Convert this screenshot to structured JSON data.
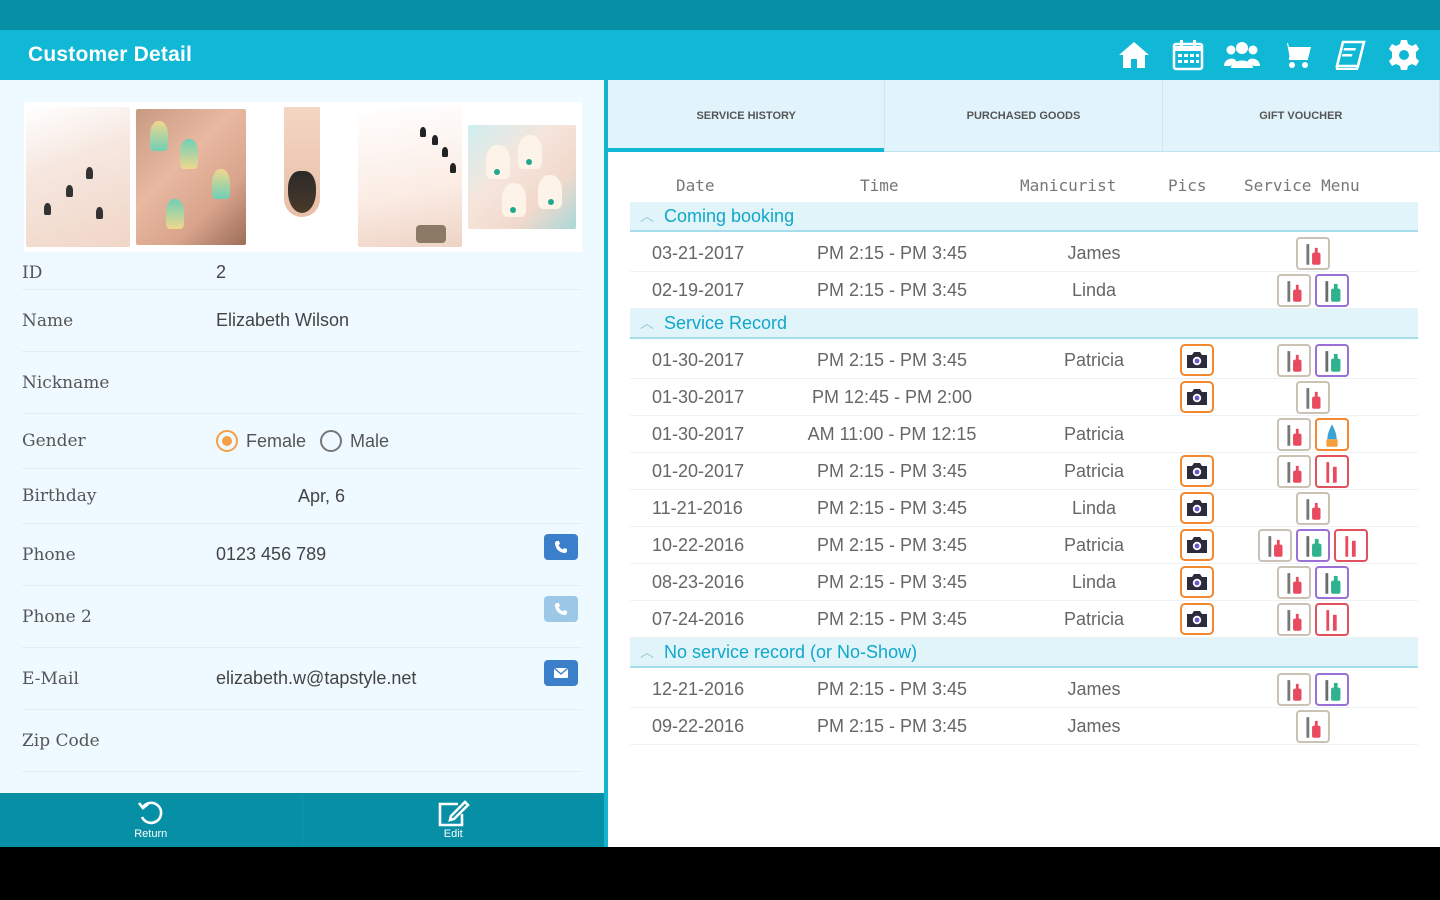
{
  "header": {
    "title": "Customer Detail",
    "icons": [
      "home-icon",
      "calendar-icon",
      "customers-icon",
      "cart-icon",
      "book-icon",
      "settings-icon"
    ]
  },
  "tabs": [
    "SERVICE HISTORY",
    "PURCHASED GOODS",
    "GIFT VOUCHER"
  ],
  "customer": {
    "id_label": "ID",
    "id": "2",
    "name_label": "Name",
    "name": "Elizabeth Wilson",
    "nickname_label": "Nickname",
    "nickname": "",
    "gender_label": "Gender",
    "gender_female": "Female",
    "gender_male": "Male",
    "gender_selected": "Female",
    "birthday_label": "Birthday",
    "birthday": "Apr, 6",
    "phone_label": "Phone",
    "phone": "0123 456 789",
    "phone2_label": "Phone 2",
    "phone2": "",
    "email_label": "E-Mail",
    "email": "elizabeth.w@tapstyle.net",
    "zip_label": "Zip Code",
    "zip": ""
  },
  "bottom": {
    "return_label": "Return",
    "edit_label": "Edit"
  },
  "table": {
    "headers": {
      "date": "Date",
      "time": "Time",
      "manicurist": "Manicurist",
      "pics": "Pics",
      "menu": "Service Menu"
    },
    "sections": [
      {
        "title": "Coming booking",
        "rows": [
          {
            "date": "03-21-2017",
            "time": "PM 2:15 - PM 3:45",
            "manicurist": "James",
            "pic": false,
            "menus": [
              "default"
            ]
          },
          {
            "date": "02-19-2017",
            "time": "PM 2:15 - PM 3:45",
            "manicurist": "Linda",
            "pic": false,
            "menus": [
              "default",
              "purple"
            ]
          }
        ]
      },
      {
        "title": "Service Record",
        "rows": [
          {
            "date": "01-30-2017",
            "time": "PM 2:15 - PM 3:45",
            "manicurist": "Patricia",
            "pic": true,
            "menus": [
              "default",
              "purple"
            ]
          },
          {
            "date": "01-30-2017",
            "time": "PM 12:45 - PM 2:00",
            "manicurist": "",
            "pic": true,
            "menus": [
              "default"
            ]
          },
          {
            "date": "01-30-2017",
            "time": "AM 11:00 - PM 12:15",
            "manicurist": "Patricia",
            "pic": false,
            "menus": [
              "default",
              "orange"
            ]
          },
          {
            "date": "01-20-2017",
            "time": "PM 2:15 - PM 3:45",
            "manicurist": "Patricia",
            "pic": true,
            "menus": [
              "default",
              "red"
            ]
          },
          {
            "date": "11-21-2016",
            "time": "PM 2:15 - PM 3:45",
            "manicurist": "Linda",
            "pic": true,
            "menus": [
              "default"
            ]
          },
          {
            "date": "10-22-2016",
            "time": "PM 2:15 - PM 3:45",
            "manicurist": "Patricia",
            "pic": true,
            "menus": [
              "default",
              "purple",
              "red"
            ]
          },
          {
            "date": "08-23-2016",
            "time": "PM 2:15 - PM 3:45",
            "manicurist": "Linda",
            "pic": true,
            "menus": [
              "default",
              "purple"
            ]
          },
          {
            "date": "07-24-2016",
            "time": "PM 2:15 - PM 3:45",
            "manicurist": "Patricia",
            "pic": true,
            "menus": [
              "default",
              "red"
            ]
          }
        ]
      },
      {
        "title": "No service record (or No-Show)",
        "rows": [
          {
            "date": "12-21-2016",
            "time": "PM 2:15 - PM 3:45",
            "manicurist": "James",
            "pic": false,
            "menus": [
              "default",
              "purple"
            ]
          },
          {
            "date": "09-22-2016",
            "time": "PM 2:15 - PM 3:45",
            "manicurist": "James",
            "pic": false,
            "menus": [
              "default"
            ]
          }
        ]
      }
    ]
  },
  "colors": {
    "accent": "#11b8d6",
    "dark_accent": "#078fa5",
    "pic_border": "#f2882f",
    "radio_selected": "#f5a046"
  }
}
